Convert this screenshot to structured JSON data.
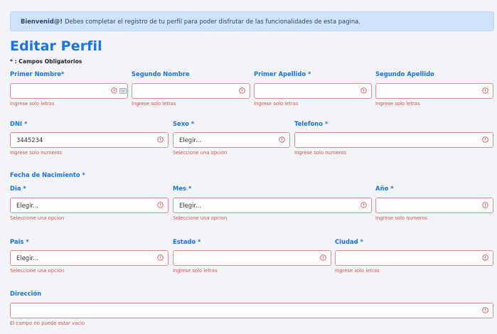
{
  "alert": {
    "strong": "Bienvenid@!",
    "text": "Debes completar el registro de tu perfil para poder disfrutar de las funcionalidades de esta pagina."
  },
  "title": "Editar Perfil",
  "required_note": "* : Campos Obligatorios",
  "fields": {
    "primer_nombre": {
      "label": "Primer Nombre*",
      "value": "",
      "hint": "Ingrese solo letras"
    },
    "segundo_nombre": {
      "label": "Segundo Nombre",
      "value": "",
      "hint": "Ingrese solo letras"
    },
    "primer_apellido": {
      "label": "Primer Apellido *",
      "value": "",
      "hint": "Ingrese solo letras"
    },
    "segundo_apellido": {
      "label": "Segundo Apellido",
      "value": "",
      "hint": "Ingrese solo letras"
    },
    "dni": {
      "label": "DNI *",
      "value": "3445234",
      "hint": "Ingrese solo numeros"
    },
    "sexo": {
      "label": "Sexo *",
      "value": "Elegir...",
      "hint": "Seleccione una opcion"
    },
    "telefono": {
      "label": "Telefono *",
      "value": "",
      "hint": "Ingrese solo numeros"
    },
    "dia": {
      "label": "Dia *",
      "value": "Elegir...",
      "hint": "Seleccione una opcion"
    },
    "mes": {
      "label": "Mes *",
      "value": "Elegir...",
      "hint": "Seleccione una opcion"
    },
    "anio": {
      "label": "Año *",
      "value": "",
      "hint": "Ingrese solo numeros"
    },
    "pais": {
      "label": "Pais *",
      "value": "Elegir...",
      "hint": "Seleccione una opcion"
    },
    "estado": {
      "label": "Estado *",
      "value": "",
      "hint": "Ingrese solo letras"
    },
    "ciudad": {
      "label": "Ciudad *",
      "value": "",
      "hint": "Ingrese solo letras"
    },
    "direccion": {
      "label": "Dirección",
      "value": "",
      "hint": "El campo no puede estar vacio"
    }
  },
  "fecha_nacimiento_label": "Fecha de Nacimiento *",
  "colors": {
    "accent": "#1a73e8",
    "error": "#d9534f",
    "alert_bg": "#cfe3fb"
  },
  "icons": {
    "error": "exclamation-circle-icon",
    "autofill": "contact-card-icon"
  }
}
